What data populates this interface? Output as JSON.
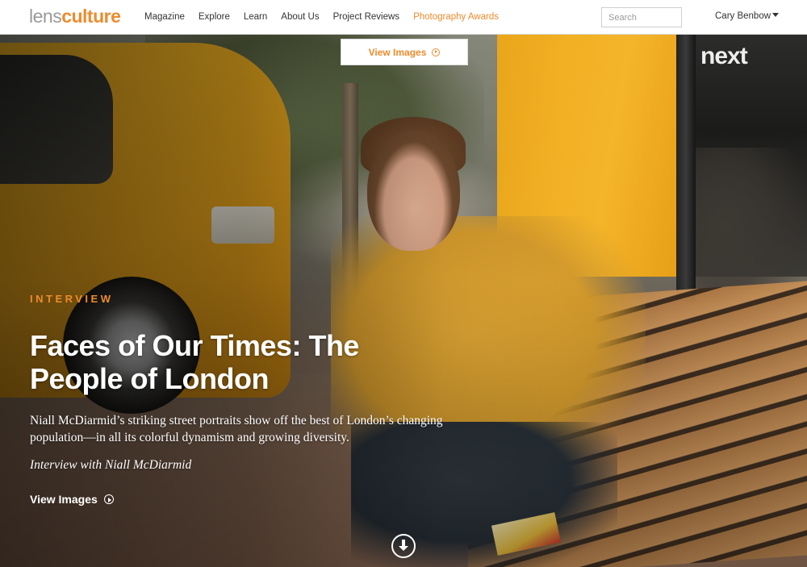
{
  "brand": {
    "logo_light": "lens",
    "logo_bold": "culture",
    "accent_color": "#ee8b2d"
  },
  "nav": {
    "items": [
      {
        "label": "Magazine"
      },
      {
        "label": "Explore"
      },
      {
        "label": "Learn"
      },
      {
        "label": "About Us"
      },
      {
        "label": "Project Reviews"
      },
      {
        "label": "Photography Awards"
      }
    ]
  },
  "search": {
    "placeholder": "Search",
    "value": ""
  },
  "user": {
    "name": "Cary Benbow"
  },
  "hero": {
    "view_images_top": "View Images",
    "kicker": "INTERVIEW",
    "title": "Faces of Our Times: The People of London",
    "dek": "Niall McDiarmid’s striking street portraits show off the best of London’s changing population—in all its colorful dynamism and growing diversity.",
    "byline": "Interview with Niall McDiarmid",
    "view_images_bottom": "View Images",
    "shop_sign": "next"
  }
}
